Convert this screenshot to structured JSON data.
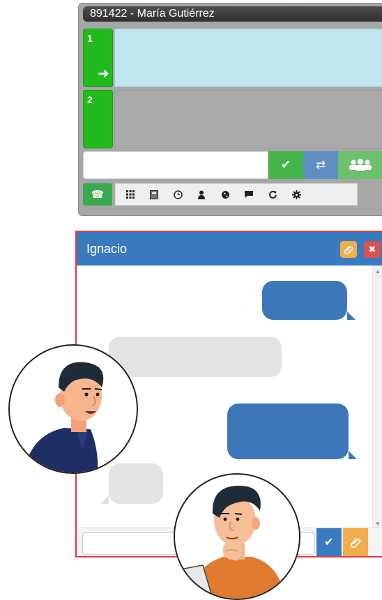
{
  "phone": {
    "title": "891422 - María Gutiérrez",
    "lines": [
      {
        "number": "1",
        "arrow": "➜"
      },
      {
        "number": "2"
      }
    ],
    "dial_input": {
      "value": "",
      "placeholder": ""
    },
    "buttons": {
      "accept_icon": "check-icon",
      "transfer_icon": "transfer-arrows-icon",
      "conference_icon": "group-icon"
    },
    "toolbar": {
      "call_icon": "phone-icon",
      "tools": [
        "keypad-icon",
        "directory-icon",
        "clock-icon",
        "user-icon",
        "globe-icon",
        "chat-icon",
        "refresh-icon",
        "gear-icon"
      ]
    }
  },
  "chat": {
    "title": "Ignacio",
    "header_buttons": [
      "paperclip-icon",
      "close-icon"
    ],
    "messages": [
      {
        "direction": "outgoing",
        "text": ""
      },
      {
        "direction": "incoming",
        "text": ""
      },
      {
        "direction": "outgoing",
        "text": ""
      },
      {
        "direction": "incoming",
        "text": ""
      }
    ],
    "input": {
      "value": "",
      "placeholder": ""
    },
    "footer_buttons": [
      "check-icon",
      "paperclip-icon"
    ]
  },
  "colors": {
    "accent_blue": "#3a7bc0",
    "green": "#22bb1e",
    "close_red": "#d9534f",
    "attach_orange": "#f0ad4e",
    "chat_border": "#e2393b"
  }
}
